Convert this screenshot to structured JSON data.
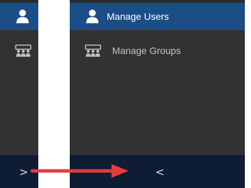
{
  "collapsed_sidebar": {
    "items": [
      {
        "icon": "user-icon",
        "active": true
      },
      {
        "icon": "group-icon",
        "active": false
      }
    ],
    "footer_toggle": ">"
  },
  "expanded_sidebar": {
    "items": [
      {
        "icon": "user-icon",
        "label": "Manage Users",
        "active": true
      },
      {
        "icon": "group-icon",
        "label": "Manage Groups",
        "active": false
      }
    ],
    "footer_toggle": "<"
  },
  "colors": {
    "sidebar_bg": "#323232",
    "active_bg": "#1b4d86",
    "footer_bg": "#0e1d33",
    "annotation_arrow": "#e8393d"
  }
}
